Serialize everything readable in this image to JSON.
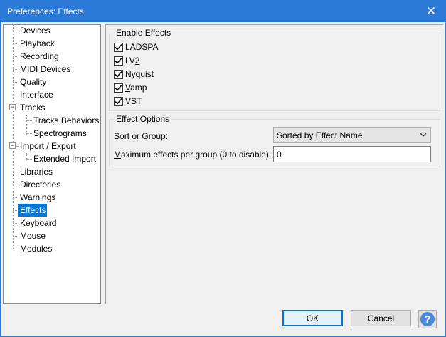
{
  "window": {
    "title": "Preferences: Effects",
    "close_glyph": "✕"
  },
  "tree": {
    "items": [
      {
        "label": "Devices"
      },
      {
        "label": "Playback"
      },
      {
        "label": "Recording"
      },
      {
        "label": "MIDI Devices"
      },
      {
        "label": "Quality"
      },
      {
        "label": "Interface"
      },
      {
        "label": "Tracks",
        "expanded": true
      },
      {
        "label": "Tracks Behaviors"
      },
      {
        "label": "Spectrograms"
      },
      {
        "label": "Import / Export",
        "expanded": true
      },
      {
        "label": "Extended Import"
      },
      {
        "label": "Libraries"
      },
      {
        "label": "Directories"
      },
      {
        "label": "Warnings"
      },
      {
        "label": "Effects",
        "selected": true
      },
      {
        "label": "Keyboard"
      },
      {
        "label": "Mouse"
      },
      {
        "label": "Modules"
      }
    ],
    "expander_glyph": "−"
  },
  "enable_effects": {
    "title": "Enable Effects",
    "items": [
      {
        "label": "LADSPA",
        "mnemonic": "L",
        "rest": "ADSPA",
        "checked": true
      },
      {
        "label": "LV2",
        "pre": "LV",
        "mnemonic": "2",
        "rest": "",
        "checked": true
      },
      {
        "label": "Nyquist",
        "pre": "N",
        "mnemonic": "y",
        "rest": "quist",
        "checked": true
      },
      {
        "label": "Vamp",
        "mnemonic": "V",
        "rest": "amp",
        "checked": true
      },
      {
        "label": "VST",
        "pre": "V",
        "mnemonic": "S",
        "rest": "T",
        "checked": true
      }
    ]
  },
  "effect_options": {
    "title": "Effect Options",
    "sort_label_mn": "S",
    "sort_label_rest": "ort or Group:",
    "sort_value": "Sorted by Effect Name",
    "max_label_mn": "M",
    "max_label_rest": "aximum effects per group (0 to disable):",
    "max_value": "0"
  },
  "buttons": {
    "ok": "OK",
    "cancel": "Cancel",
    "help": "?"
  },
  "colors": {
    "titlebar": "#2b79d7",
    "selection": "#0078d7",
    "help_icon": "#4a8ad8"
  }
}
